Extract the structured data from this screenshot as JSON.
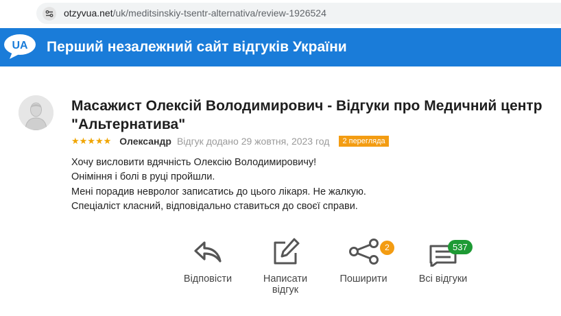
{
  "browser": {
    "url_host": "otzyvua.net",
    "url_path": "/uk/meditsinskiy-tsentr-alternativa/review-1926524"
  },
  "header": {
    "logo_text": "UA",
    "title": "Перший незалежний сайт відгуків України"
  },
  "review": {
    "title": "Масажист Олексій Володимирович - Відгуки про Медичний центр \"Альтернатива\"",
    "stars": "★★★★★",
    "rating": 5,
    "author": "Олександр",
    "date": "Відгук додано 29 жовтня, 2023 год",
    "views": "2 перегляда",
    "lines": [
      "Хочу висловити вдячність Олексію Володимировичу!",
      "Оніміння і болі в руці пройшли.",
      "Мені порадив невролог записатись до цього лікаря. Не жалкую.",
      "Спеціаліст класний, відповідально ставиться до своєї справи."
    ]
  },
  "actions": {
    "reply": "Відповісти",
    "write_line1": "Написати",
    "write_line2": "відгук",
    "share": "Поширити",
    "share_count": "2",
    "all": "Всі відгуки",
    "all_count": "537"
  },
  "colors": {
    "header_bg": "#1a7cd9",
    "star": "#f0a500",
    "badge_orange": "#f39c12",
    "badge_green": "#1e9a34"
  },
  "icons": {
    "site_info": "site-info-icon",
    "reply": "reply-arrow-icon",
    "write": "pencil-square-icon",
    "share": "share-nodes-icon",
    "all_reviews": "chat-bubble-icon"
  }
}
